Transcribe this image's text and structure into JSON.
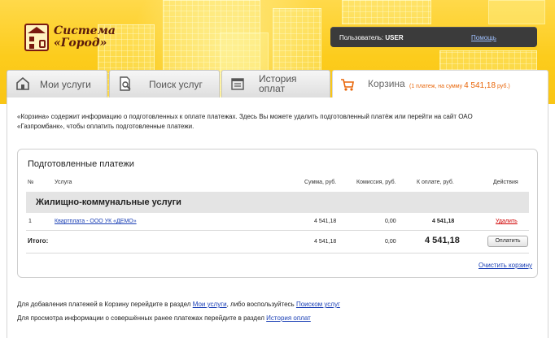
{
  "header": {
    "logo": {
      "line1": "Система",
      "line2": "«Город»"
    },
    "user": {
      "label": "Пользователь:",
      "name": "USER",
      "help_link": "Помощь"
    }
  },
  "tabs": [
    {
      "id": "services",
      "label": "Мои услуги",
      "icon": "house-icon"
    },
    {
      "id": "search",
      "label": "Поиск услуг",
      "icon": "document-search-icon"
    },
    {
      "id": "history",
      "label_line1": "История",
      "label_line2": "оплат",
      "icon": "calendar-list-icon"
    },
    {
      "id": "cart",
      "label": "Корзина",
      "summary_prefix": "(1 платеж, на сумму",
      "summary_amount": "4 541,18",
      "summary_suffix": "руб.)",
      "icon": "cart-icon",
      "active": true
    }
  ],
  "intro": "«Корзина» содержит информацию о подготовленных к оплате платежах. Здесь Вы можете удалить подготовленный платёж или перейти на сайт ОАО «Газпромбанк», чтобы оплатить подготовленные платежи.",
  "payments": {
    "title": "Подготовленные платежи",
    "columns": [
      "№",
      "Услуга",
      "Сумма, руб.",
      "Комиссия, руб.",
      "К оплате, руб.",
      "Действия"
    ],
    "group": "Жилищно-коммунальные услуги",
    "rows": [
      {
        "num": "1",
        "service": "Квартплата - ООО УК «ДЕМО»",
        "sum": "4 541,18",
        "commission": "0,00",
        "to_pay": "4 541,18",
        "action": "Удалить"
      }
    ],
    "total": {
      "label": "Итого:",
      "sum": "4 541,18",
      "commission": "0,00",
      "to_pay": "4 541,18",
      "button": "Оплатить"
    },
    "clear_link": "Очистить корзину"
  },
  "notes": {
    "line1_prefix": "Для добавления платежей в Корзину перейдите в раздел",
    "line1_link1": "Мои услуги",
    "line1_mid": ", либо воспользуйтесь",
    "line1_link2": "Поиском услуг",
    "line2_prefix": "Для просмотра информации о совершённых ранее платежах перейдите в раздел",
    "line2_link": "История оплат"
  },
  "colors": {
    "header_yellow": "#fccc1c",
    "accent_orange": "#e8660a",
    "link_blue": "#1a3fb5",
    "delete_red": "#d00000"
  }
}
